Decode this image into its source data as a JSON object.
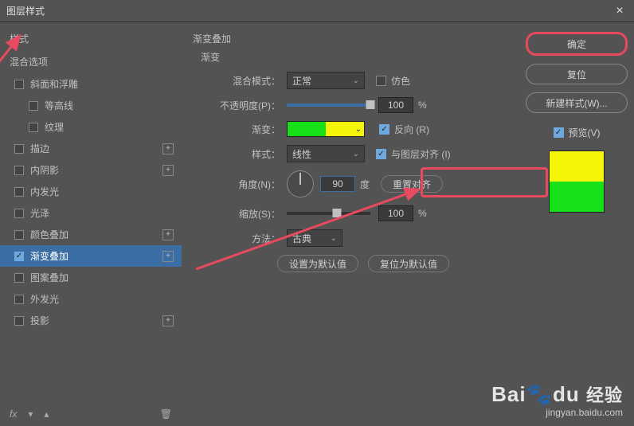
{
  "window": {
    "title": "图层样式",
    "close": "×"
  },
  "sidebar": {
    "styles_head": "样式",
    "blend_head": "混合选项",
    "items": [
      {
        "label": "斜面和浮雕",
        "checked": false,
        "plus": false
      },
      {
        "label": "等高线",
        "checked": false,
        "plus": false,
        "indent": true
      },
      {
        "label": "纹理",
        "checked": false,
        "plus": false,
        "indent": true
      },
      {
        "label": "描边",
        "checked": false,
        "plus": true
      },
      {
        "label": "内阴影",
        "checked": false,
        "plus": true
      },
      {
        "label": "内发光",
        "checked": false,
        "plus": false
      },
      {
        "label": "光泽",
        "checked": false,
        "plus": false
      },
      {
        "label": "颜色叠加",
        "checked": false,
        "plus": true
      },
      {
        "label": "渐变叠加",
        "checked": true,
        "plus": true,
        "active": true
      },
      {
        "label": "图案叠加",
        "checked": false,
        "plus": false
      },
      {
        "label": "外发光",
        "checked": false,
        "plus": false
      },
      {
        "label": "投影",
        "checked": false,
        "plus": true
      }
    ],
    "fx": "fx",
    "trash": "🗑"
  },
  "panel": {
    "title": "渐变叠加",
    "sub": "渐变",
    "blend_mode_label": "混合模式：",
    "blend_mode_value": "正常",
    "dither_label": "仿色",
    "opacity_label": "不透明度(P)：",
    "opacity_value": "100",
    "percent": "%",
    "gradient_label": "渐变：",
    "reverse_label": "反向 (R)",
    "style_label": "样式：",
    "style_value": "线性",
    "align_label": "与图层对齐 (I)",
    "angle_label": "角度(N)：",
    "angle_value": "90",
    "degree": "度",
    "reset_align": "重置对齐",
    "scale_label": "缩放(S)：",
    "scale_value": "100",
    "method_label": "方法：",
    "method_value": "古典",
    "set_default": "设置为默认值",
    "reset_default": "复位为默认值"
  },
  "right": {
    "ok": "确定",
    "reset": "复位",
    "new_style": "新建样式(W)...",
    "preview_label": "预览(V)"
  },
  "watermark": {
    "brand": "Bai",
    "brand2": "du",
    "cn": "经验",
    "url": "jingyan.baidu.com"
  }
}
